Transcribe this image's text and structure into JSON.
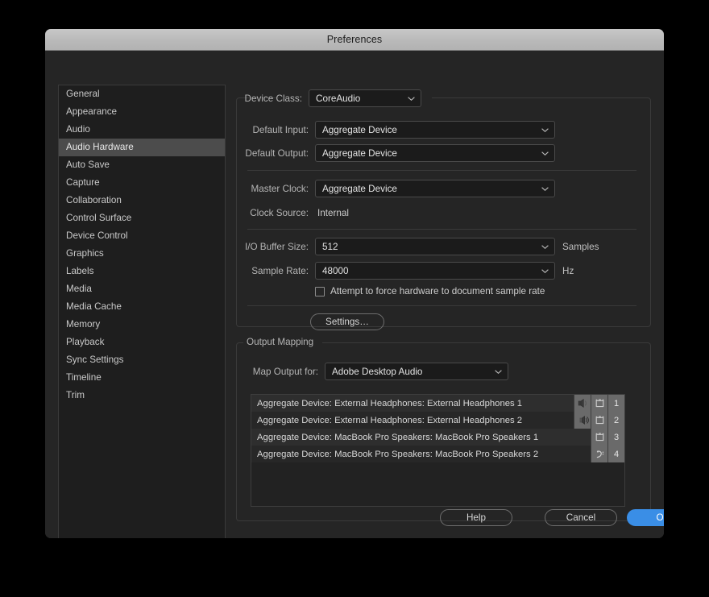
{
  "window": {
    "title": "Preferences"
  },
  "sidebar": {
    "items": [
      {
        "label": "General",
        "selected": false
      },
      {
        "label": "Appearance",
        "selected": false
      },
      {
        "label": "Audio",
        "selected": false
      },
      {
        "label": "Audio Hardware",
        "selected": true
      },
      {
        "label": "Auto Save",
        "selected": false
      },
      {
        "label": "Capture",
        "selected": false
      },
      {
        "label": "Collaboration",
        "selected": false
      },
      {
        "label": "Control Surface",
        "selected": false
      },
      {
        "label": "Device Control",
        "selected": false
      },
      {
        "label": "Graphics",
        "selected": false
      },
      {
        "label": "Labels",
        "selected": false
      },
      {
        "label": "Media",
        "selected": false
      },
      {
        "label": "Media Cache",
        "selected": false
      },
      {
        "label": "Memory",
        "selected": false
      },
      {
        "label": "Playback",
        "selected": false
      },
      {
        "label": "Sync Settings",
        "selected": false
      },
      {
        "label": "Timeline",
        "selected": false
      },
      {
        "label": "Trim",
        "selected": false
      }
    ]
  },
  "device_group": {
    "device_class": {
      "label": "Device Class:",
      "value": "CoreAudio"
    },
    "default_input": {
      "label": "Default Input:",
      "value": "Aggregate Device"
    },
    "default_output": {
      "label": "Default Output:",
      "value": "Aggregate Device"
    },
    "master_clock": {
      "label": "Master Clock:",
      "value": "Aggregate Device"
    },
    "clock_source": {
      "label": "Clock Source:",
      "value": "Internal"
    },
    "io_buffer_size": {
      "label": "I/O Buffer Size:",
      "value": "512",
      "unit": "Samples"
    },
    "sample_rate": {
      "label": "Sample Rate:",
      "value": "48000",
      "unit": "Hz"
    },
    "force_sample_rate": {
      "label": "Attempt to force hardware to document sample rate",
      "checked": false
    },
    "settings_button": "Settings…"
  },
  "output_mapping": {
    "legend": "Output Mapping",
    "map_output_for": {
      "label": "Map Output for:",
      "value": "Adobe Desktop Audio"
    },
    "rows": [
      {
        "label": "Aggregate Device: External Headphones: External Headphones 1",
        "pan_icon": "pan-left-icon",
        "channel_icon": "audio-channel-icon",
        "number": "1"
      },
      {
        "label": "Aggregate Device: External Headphones: External Headphones 2",
        "pan_icon": "pan-right-icon",
        "channel_icon": "audio-channel-icon",
        "number": "2"
      },
      {
        "label": "Aggregate Device: MacBook Pro Speakers: MacBook Pro Speakers 1",
        "pan_icon": "",
        "channel_icon": "audio-channel-icon",
        "number": "3"
      },
      {
        "label": "Aggregate Device: MacBook Pro Speakers: MacBook Pro Speakers 2",
        "pan_icon": "",
        "channel_icon": "bass-clef-icon",
        "number": "4"
      }
    ]
  },
  "footer": {
    "help": "Help",
    "cancel": "Cancel",
    "ok": "OK"
  },
  "colors": {
    "accent": "#3a8ee6",
    "dialog_bg": "#252525",
    "titlebar": "#bababa",
    "selected_row": "#4c4c4c"
  }
}
